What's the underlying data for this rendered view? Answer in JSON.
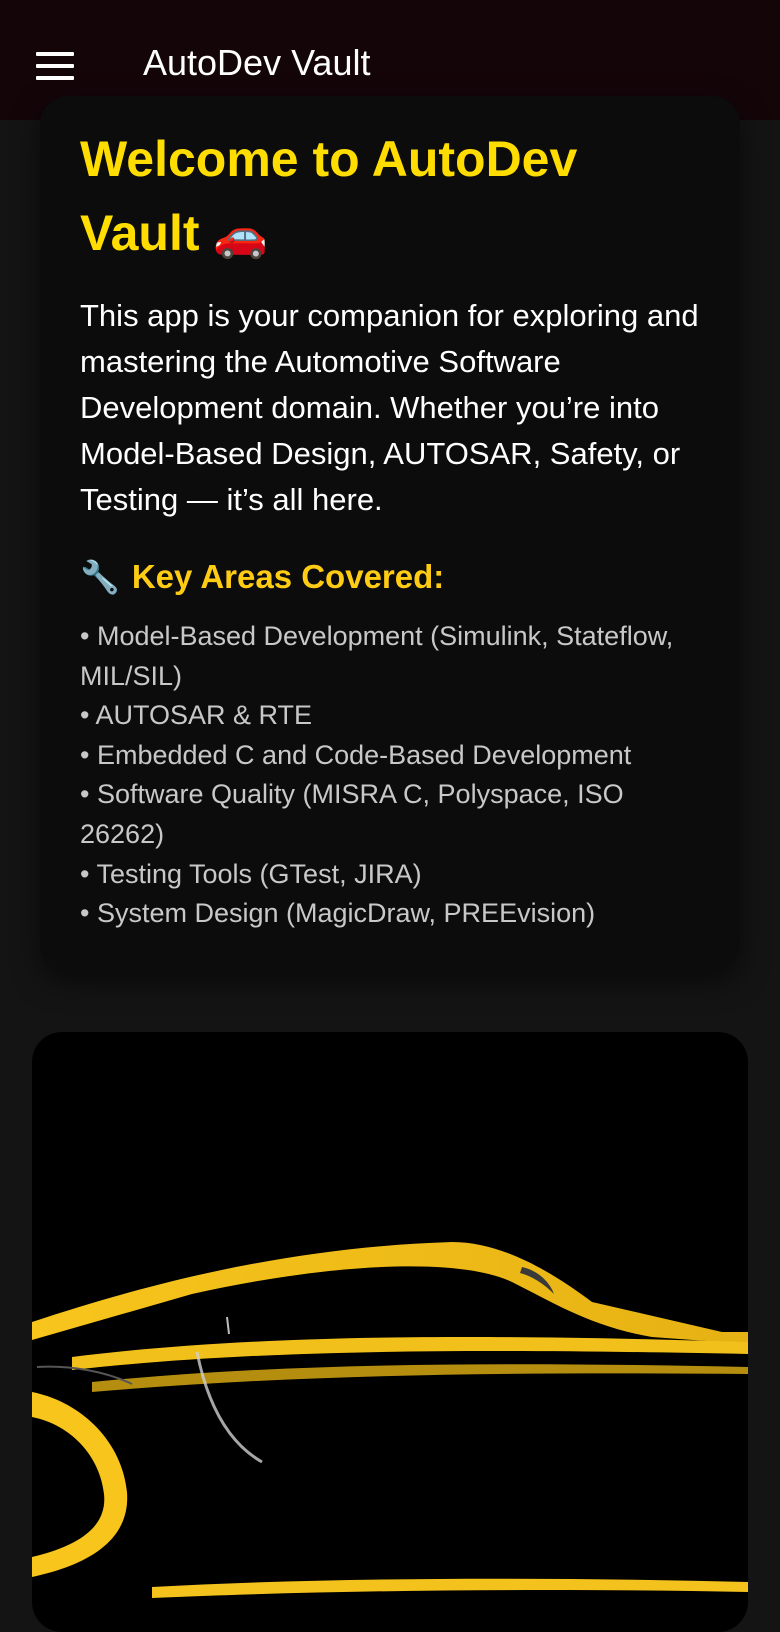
{
  "app_bar": {
    "title": "AutoDev Vault",
    "menu_icon": "hamburger-menu-icon"
  },
  "card": {
    "title_line1": "Welcome to AutoDev",
    "title_line2": "Vault",
    "title_emoji": "🚗",
    "intro": "This app is your companion for exploring and mastering the Automotive Software Development domain. Whether you’re into Model-Based Design, AUTOSAR, Safety, or Testing — it’s all here.",
    "section_icon": "🔧",
    "section_heading": "Key Areas Covered:",
    "areas": [
      "• Model-Based Development (Simulink, Stateflow, MIL/SIL)",
      "• AUTOSAR & RTE",
      "• Embedded C and Code-Based Development",
      "• Software Quality (MISRA C, Polyspace, ISO 26262)",
      "• Testing Tools (GTest, JIRA)",
      "• System Design (MagicDraw, PREEvision)"
    ]
  },
  "hero": {
    "image": "car-silhouette-logo",
    "colors": {
      "accent": "#f4c21c",
      "background": "#000000"
    }
  },
  "colors": {
    "app_bar_bg": "#140509",
    "page_bg": "#141414",
    "card_bg": "#0c0c0c",
    "title_yellow": "#ffdd00",
    "heading_yellow": "#ffcc14",
    "list_text": "#c8c8c8"
  }
}
